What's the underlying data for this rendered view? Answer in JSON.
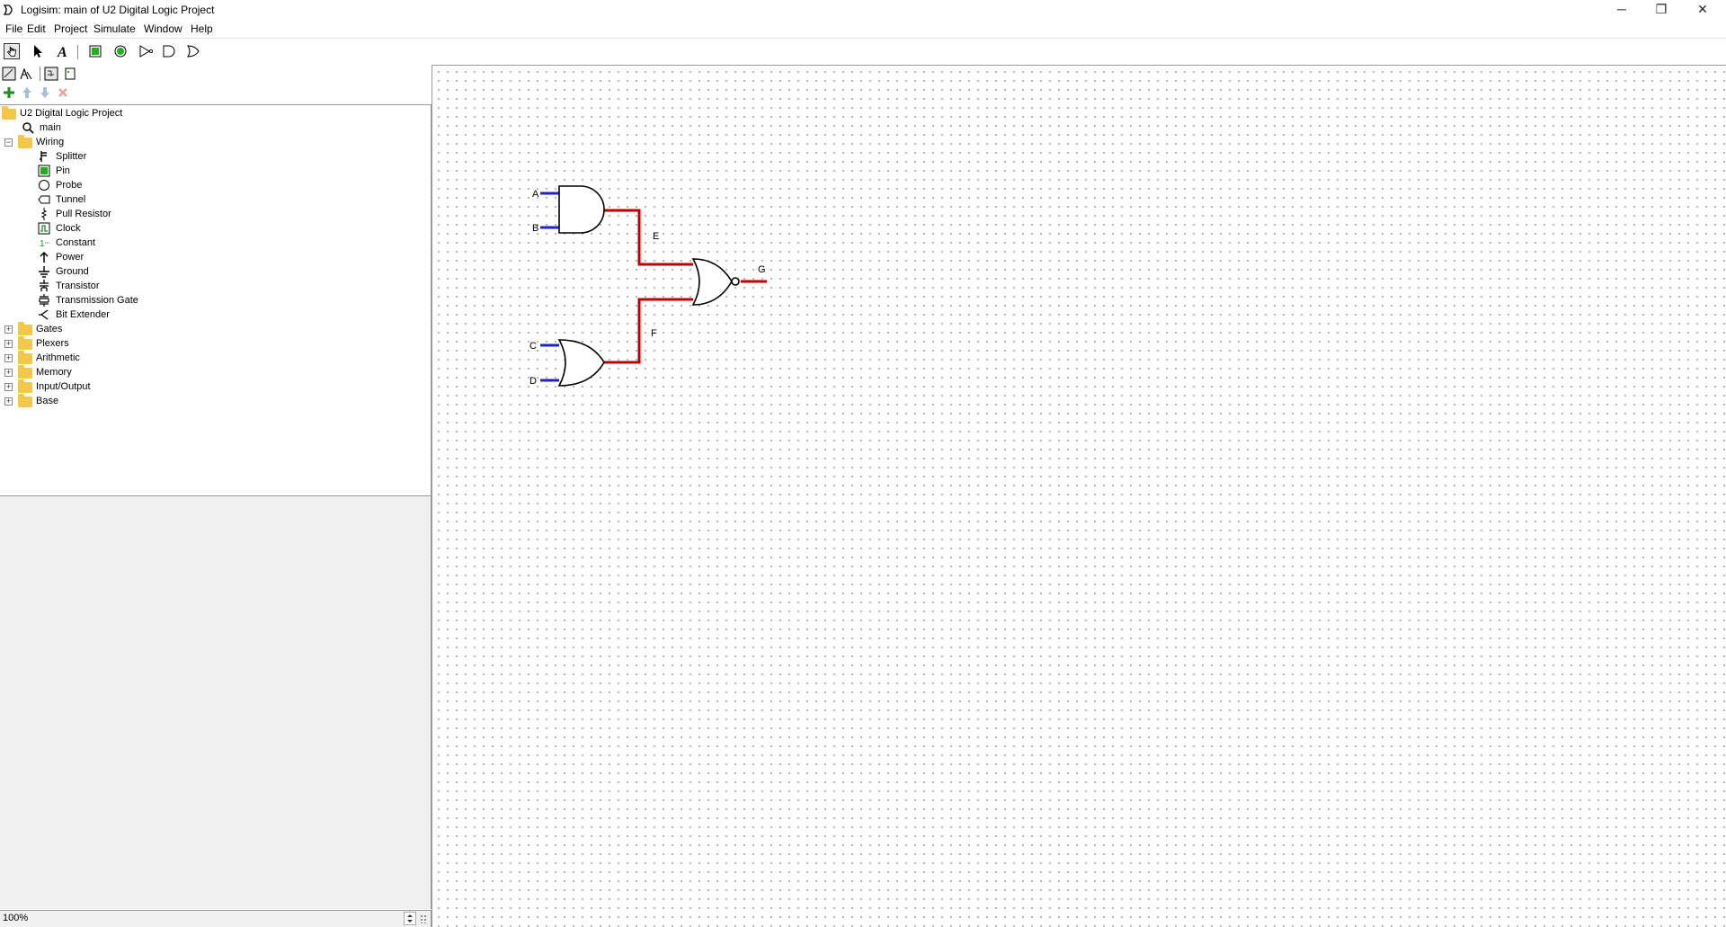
{
  "window": {
    "title": "Logisim: main of U2 Digital Logic Project",
    "minimize": "─",
    "maximize": "❐",
    "close": "✕"
  },
  "menu": [
    "File",
    "Edit",
    "Project",
    "Simulate",
    "Window",
    "Help"
  ],
  "toolbar": {
    "tools": [
      "poke-tool-icon",
      "select-tool-icon",
      "text-tool-icon",
      "input-pin-icon",
      "output-pin-icon",
      "not-gate-icon",
      "and-gate-icon",
      "or-gate-icon"
    ],
    "selected": "poke-tool-icon"
  },
  "explorer": {
    "project": "U2 Digital Logic Project",
    "circuit": "main",
    "wiring": {
      "label": "Wiring",
      "items": [
        "Splitter",
        "Pin",
        "Probe",
        "Tunnel",
        "Pull Resistor",
        "Clock",
        "Constant",
        "Power",
        "Ground",
        "Transistor",
        "Transmission Gate",
        "Bit Extender"
      ]
    },
    "libraries": [
      "Gates",
      "Plexers",
      "Arithmetic",
      "Memory",
      "Input/Output",
      "Base"
    ]
  },
  "zoom": "100%",
  "circuit": {
    "inputs": [
      "A",
      "B",
      "C",
      "D"
    ],
    "intermediate": [
      "E",
      "F"
    ],
    "output": "G",
    "colors": {
      "high": "#c00000",
      "input": "#2020d0"
    }
  }
}
